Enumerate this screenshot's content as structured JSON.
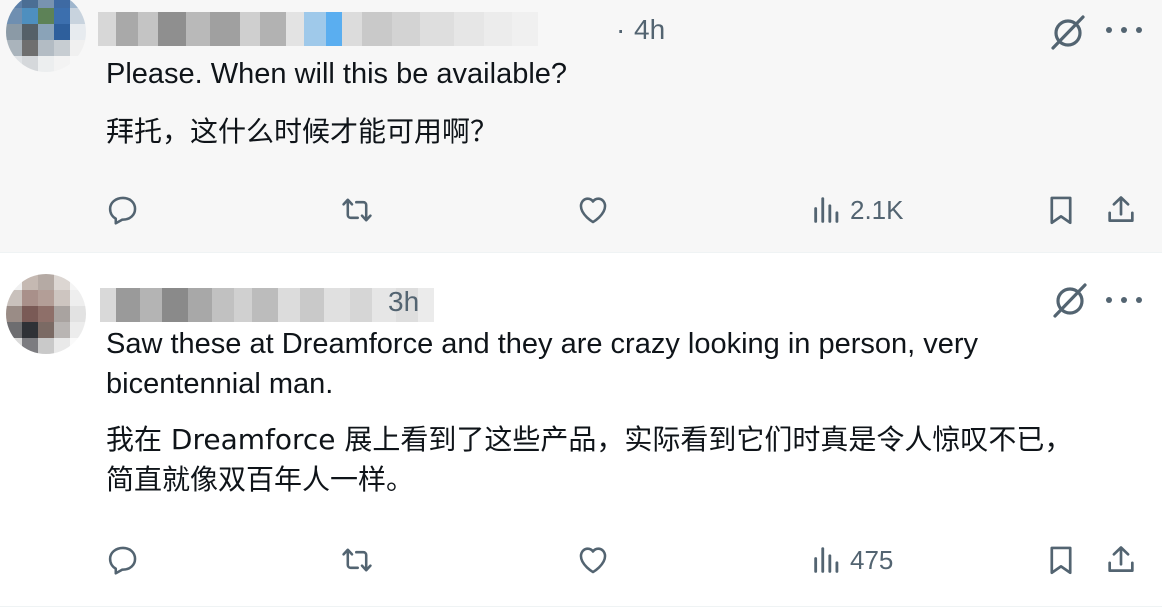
{
  "posts": [
    {
      "time": "4h",
      "separator": "·",
      "text_en": "Please. When will this be available?",
      "text_cn": "拜托，这什么时候才能可用啊？",
      "views": "2.1K"
    },
    {
      "time": "3h",
      "separator": "",
      "text_en_line1": "Saw these at Dreamforce and they are crazy looking in person, very",
      "text_en_line2": "bicentennial man.",
      "text_cn_line1": "我在 Dreamforce 展上看到了这些产品，实际看到它们时真是令人惊叹不已，",
      "text_cn_line2": "简直就像双百年人一样。",
      "views": "475"
    }
  ],
  "icons": [
    "reply-icon",
    "repost-icon",
    "like-icon",
    "views-icon",
    "bookmark-icon",
    "share-icon",
    "grok-icon",
    "more-icon"
  ],
  "colors": {
    "icon": "#536471",
    "text": "#0f1419",
    "post1_bg": "#f7f7f7",
    "post2_bg": "#ffffff"
  }
}
